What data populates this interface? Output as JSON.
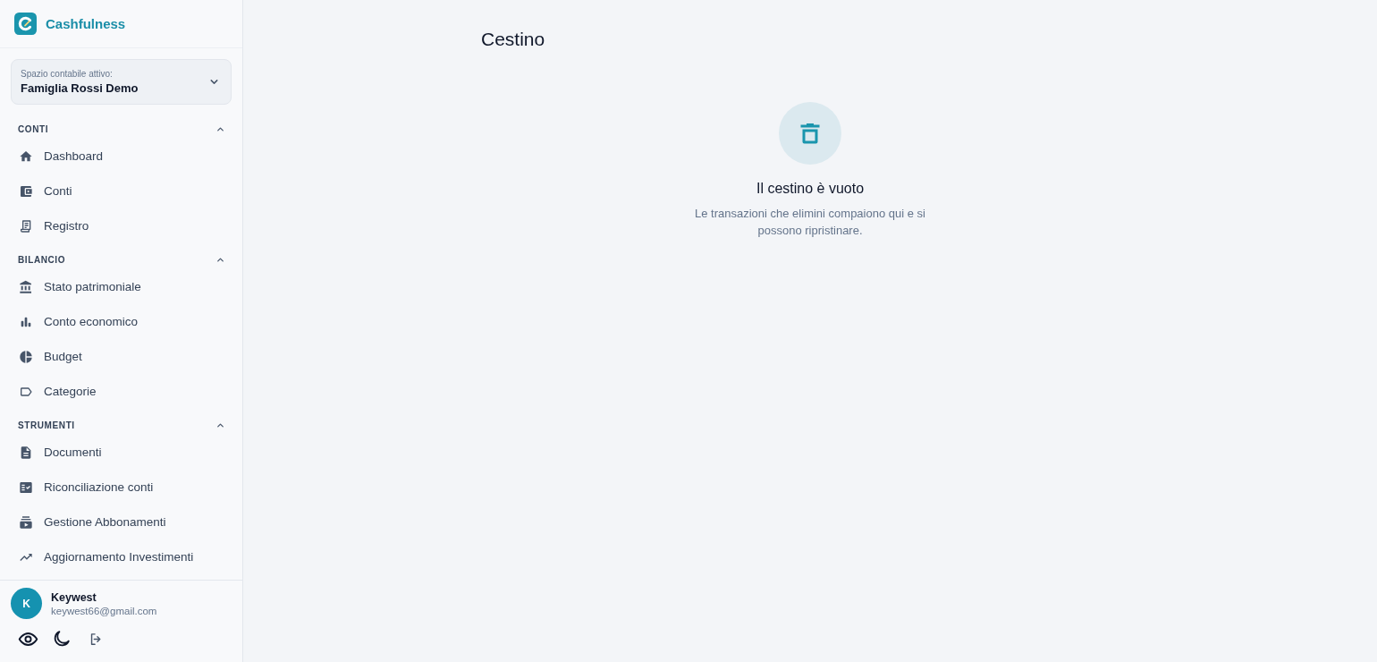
{
  "app": {
    "name": "Cashfulness"
  },
  "workspace": {
    "label": "Spazio contabile attivo:",
    "value": "Famiglia Rossi Demo"
  },
  "sidebar": {
    "sections": [
      {
        "title": "CONTI",
        "expanded": true,
        "items": [
          {
            "label": "Dashboard",
            "selected": false
          },
          {
            "label": "Conti",
            "selected": false
          },
          {
            "label": "Registro",
            "selected": false
          }
        ]
      },
      {
        "title": "BILANCIO",
        "expanded": true,
        "items": [
          {
            "label": "Stato patrimoniale",
            "selected": false
          },
          {
            "label": "Conto economico",
            "selected": false
          },
          {
            "label": "Budget",
            "selected": false
          },
          {
            "label": "Categorie",
            "selected": false
          }
        ]
      },
      {
        "title": "STRUMENTI",
        "expanded": true,
        "items": [
          {
            "label": "Documenti",
            "selected": false
          },
          {
            "label": "Riconciliazione conti",
            "selected": false
          },
          {
            "label": "Gestione Abbonamenti",
            "selected": false
          },
          {
            "label": "Aggiornamento Investimenti",
            "selected": false
          }
        ]
      }
    ]
  },
  "user": {
    "initial": "K",
    "name": "Keywest",
    "email": "keywest66@gmail.com"
  },
  "page": {
    "title": "Cestino"
  },
  "empty_state": {
    "title": "Il cestino è vuoto",
    "message": "Le transazioni che elimini compaiono qui e si possono ripristinare."
  }
}
